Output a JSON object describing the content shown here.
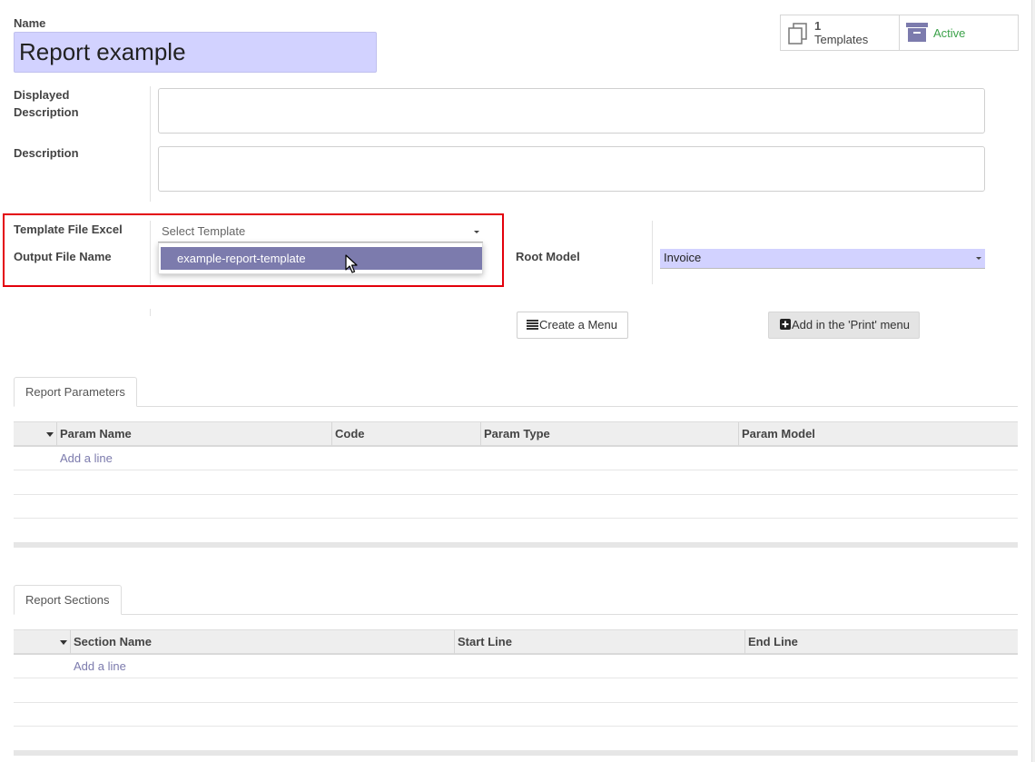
{
  "form": {
    "name_label": "Name",
    "name_value": "Report example",
    "displayed_description_label_line1": "Displayed",
    "displayed_description_label_line2": "Description",
    "displayed_description_value": "",
    "description_label": "Description",
    "description_value": "",
    "template_file_label": "Template File Excel",
    "template_file_placeholder": "Select Template",
    "output_file_label": "Output File Name",
    "root_model_label": "Root Model",
    "root_model_value": "Invoice"
  },
  "smart_buttons": {
    "templates_count": "1",
    "templates_label": "Templates",
    "active_label": "Active",
    "active_color": "#3ca24a"
  },
  "dropdown": {
    "options": [
      "example-report-template"
    ]
  },
  "actions": {
    "create_menu_label": "Create a Menu",
    "add_print_label": "Add in the 'Print' menu"
  },
  "tabs": {
    "parameters": {
      "label": "Report Parameters",
      "columns": [
        "Param Name",
        "Code",
        "Param Type",
        "Param Model"
      ],
      "add_line": "Add a line"
    },
    "sections": {
      "label": "Report Sections",
      "columns": [
        "Section Name",
        "Start Line",
        "End Line"
      ],
      "add_line": "Add a line"
    }
  },
  "colors": {
    "accent": "#7c7bad",
    "field_highlight": "#d2d2ff",
    "annotation_red": "#e3000b"
  }
}
